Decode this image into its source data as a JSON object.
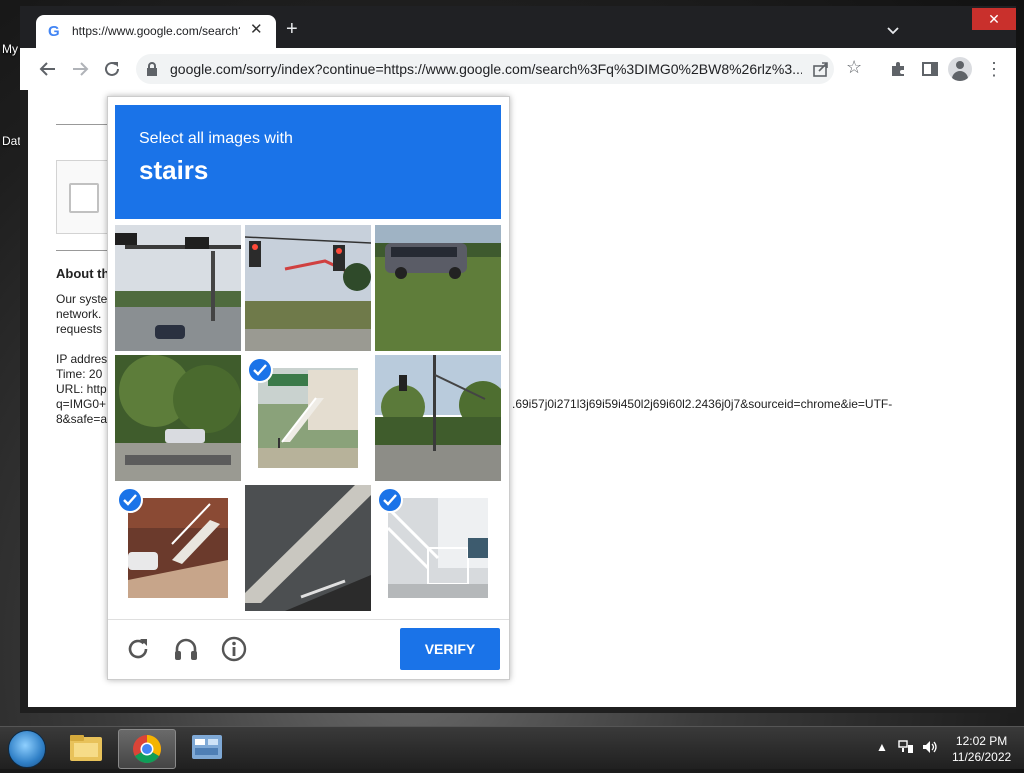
{
  "desktop": {
    "icon_label_1": "My",
    "icon_label_2": "Dat"
  },
  "browser": {
    "tab": {
      "title": "https://www.google.com/search?"
    },
    "url": "google.com/sorry/index?continue=https://www.google.com/search%3Fq%3DIMG0%2BW8%26rlz%3..."
  },
  "page": {
    "about_heading": "About th",
    "para_lines": [
      "Our syste",
      "network.",
      "requests"
    ],
    "info_lines": [
      "IP addres",
      "Time: 20",
      "URL: http",
      "q=IMG0+",
      "8&safe=a"
    ],
    "url_tail": ".69i57j0i271l3j69i59i450l2j69i60l2.2436j0j7&sourceid=chrome&ie=UTF-"
  },
  "captcha": {
    "instruction": "Select all images with",
    "object": "stairs",
    "tiles": [
      {
        "selected": false,
        "scene": "street-intersection"
      },
      {
        "selected": false,
        "scene": "traffic-light-crane"
      },
      {
        "selected": false,
        "scene": "van-on-grass"
      },
      {
        "selected": false,
        "scene": "tree-cars"
      },
      {
        "selected": true,
        "scene": "house-stairs"
      },
      {
        "selected": false,
        "scene": "street-trees"
      },
      {
        "selected": true,
        "scene": "outdoor-stairs-red"
      },
      {
        "selected": false,
        "scene": "road-curb"
      },
      {
        "selected": true,
        "scene": "white-stairs-railing"
      }
    ],
    "verify_label": "VERIFY"
  },
  "taskbar": {
    "time": "12:02 PM",
    "date": "11/26/2022"
  },
  "colors": {
    "accent": "#1a73e8"
  }
}
